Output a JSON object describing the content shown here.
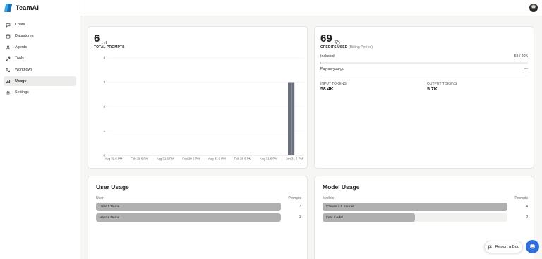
{
  "app": {
    "name": "TeamAI"
  },
  "sidebar": {
    "items": [
      {
        "label": "Chats",
        "icon": "chat-bubble-icon"
      },
      {
        "label": "Datastores",
        "icon": "database-icon"
      },
      {
        "label": "Agents",
        "icon": "user-icon"
      },
      {
        "label": "Tools",
        "icon": "wrench-icon"
      },
      {
        "label": "Workflows",
        "icon": "workflow-icon"
      },
      {
        "label": "Usage",
        "icon": "bar-chart-icon",
        "active": true
      },
      {
        "label": "Settings",
        "icon": "gear-icon"
      }
    ]
  },
  "prompts_card": {
    "value": "6",
    "label": "TOTAL PROMPTS"
  },
  "credits_card": {
    "value": "69",
    "label": "CREDITS USED",
    "sublabel": "(Billing Period)",
    "included_label": "Included",
    "included_value": "69 / 20K",
    "included_fraction": 0.00345,
    "payg_label": "Pay-as-you-go",
    "payg_value": "---",
    "input_tokens_label": "INPUT TOKENS",
    "input_tokens_value": "58.4K",
    "output_tokens_label": "OUTPUT TOKENS",
    "output_tokens_value": "5.7K"
  },
  "chart_data": {
    "type": "bar",
    "categories": [
      "Aug 31 6 PM",
      "Feb 28 6 PM",
      "Aug 31 6 PM",
      "Feb 29 6 PM",
      "Aug 31 6 PM",
      "Feb 28 6 PM",
      "Aug 31 6 PM",
      "Jan 31 6 PM"
    ],
    "x_tick_labels": [
      "Aug 31 6 PM",
      "Feb 28 6 PM",
      "Aug 31 6 PM",
      "Feb 29 6 PM",
      "Aug 31 6 PM",
      "Feb 28 6 PM",
      "Aug 31 6 PM",
      "Jan 31 6 PM"
    ],
    "bars": [
      {
        "x": "Jan 31 6 PM",
        "value": 3
      },
      {
        "x": "Jan 31 6 PM",
        "value": 3
      }
    ],
    "yticks": [
      0,
      1,
      2,
      3,
      4
    ],
    "ylim": [
      0,
      4
    ],
    "bar_color": "#6b7080",
    "grid": true
  },
  "user_usage": {
    "title": "User Usage",
    "col_name": "User",
    "col_value": "Prompts",
    "rows": [
      {
        "name": "User 1 Name",
        "value": "3",
        "fraction": 1.0
      },
      {
        "name": "User 2 Name",
        "value": "3",
        "fraction": 1.0
      }
    ]
  },
  "model_usage": {
    "title": "Model Usage",
    "col_name": "Models",
    "col_value": "Prompts",
    "rows": [
      {
        "name": "Claude 4.5 Sonnet",
        "value": "4",
        "fraction": 1.0
      },
      {
        "name": "Fast model",
        "value": "2",
        "fraction": 0.5
      }
    ]
  },
  "floating": {
    "report_bug": "Report a Bug"
  }
}
